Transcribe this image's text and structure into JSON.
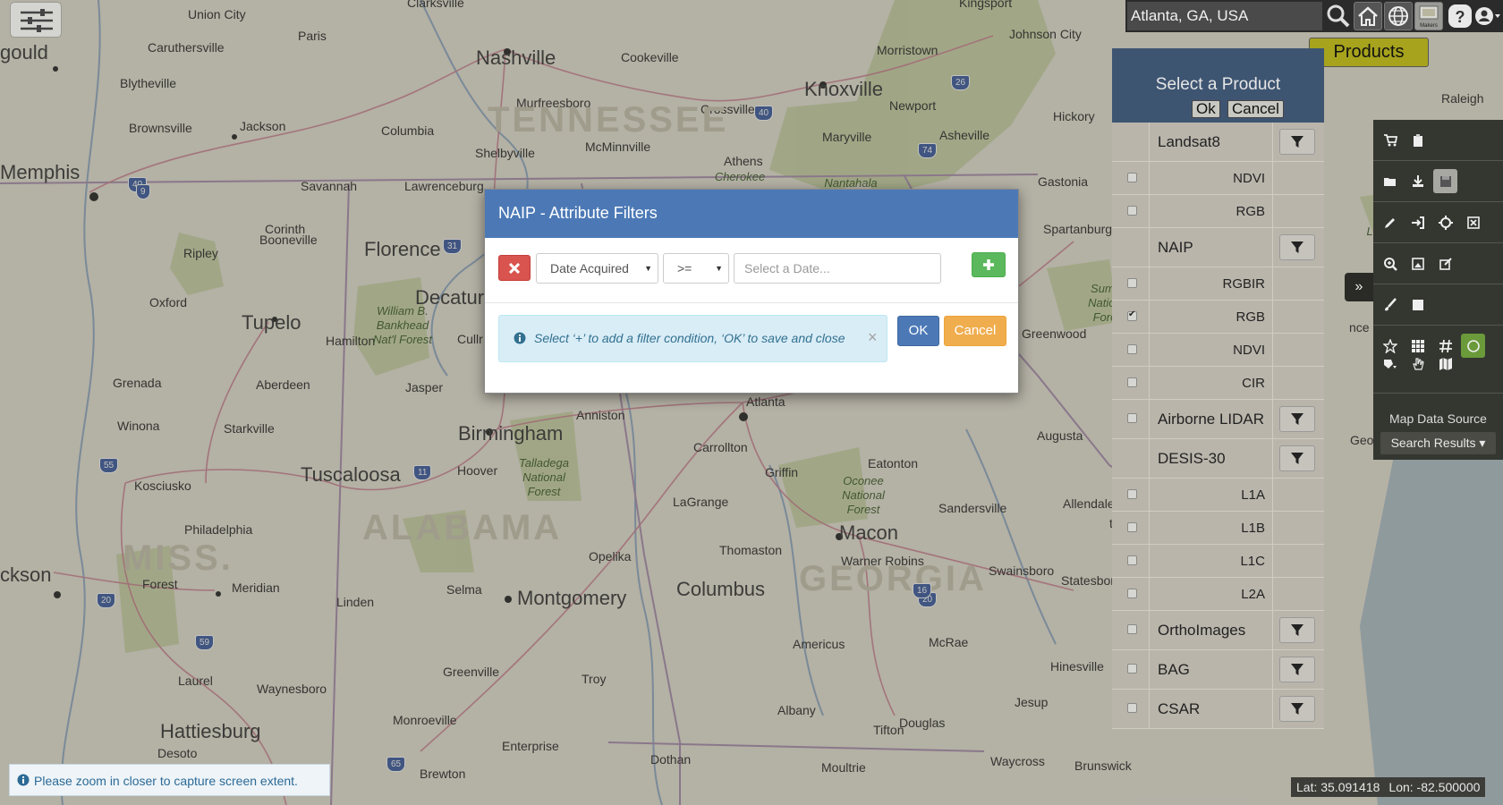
{
  "map": {
    "labels": [
      {
        "text": "Union City",
        "cls": ""
      },
      {
        "text": "Clarksville",
        "cls": ""
      },
      {
        "text": "Kingsport",
        "cls": ""
      },
      {
        "text": "Paris",
        "cls": ""
      },
      {
        "text": "Johnson City",
        "cls": ""
      },
      {
        "text": "Caruthersville",
        "cls": ""
      },
      {
        "text": "Nashville",
        "cls": "big"
      },
      {
        "text": "Cookeville",
        "cls": ""
      },
      {
        "text": "Morristown",
        "cls": ""
      },
      {
        "text": "Blytheville",
        "cls": ""
      },
      {
        "text": "Murfreesboro",
        "cls": ""
      },
      {
        "text": "Knoxville",
        "cls": "big"
      },
      {
        "text": "Raleigh",
        "cls": ""
      },
      {
        "text": "Brownsville",
        "cls": ""
      },
      {
        "text": "Jackson",
        "cls": ""
      },
      {
        "text": "Columbia",
        "cls": ""
      },
      {
        "text": "Crossville",
        "cls": ""
      },
      {
        "text": "Newport",
        "cls": ""
      },
      {
        "text": "Hickory",
        "cls": ""
      },
      {
        "text": "TENNESSEE",
        "cls": "state"
      },
      {
        "text": "Maryville",
        "cls": ""
      },
      {
        "text": "Asheville",
        "cls": ""
      },
      {
        "text": "Shelbyville",
        "cls": ""
      },
      {
        "text": "McMinnville",
        "cls": ""
      },
      {
        "text": "Memphis",
        "cls": "big"
      },
      {
        "text": "Athens",
        "cls": ""
      },
      {
        "text": "Savannah",
        "cls": ""
      },
      {
        "text": "Lawrenceburg",
        "cls": ""
      },
      {
        "text": "Gastonia",
        "cls": ""
      },
      {
        "text": "Corinth",
        "cls": ""
      },
      {
        "text": "Spartanburg",
        "cls": ""
      },
      {
        "text": "Ripley",
        "cls": ""
      },
      {
        "text": "Booneville",
        "cls": ""
      },
      {
        "text": "Florence",
        "cls": "big"
      },
      {
        "text": "Decatur",
        "cls": "big"
      },
      {
        "text": "Oxford",
        "cls": ""
      },
      {
        "text": "Tupelo",
        "cls": "big"
      },
      {
        "text": "Hamilton",
        "cls": ""
      },
      {
        "text": "Greenwood",
        "cls": ""
      },
      {
        "text": "Grenada",
        "cls": ""
      },
      {
        "text": "Aberdeen",
        "cls": ""
      },
      {
        "text": "Jasper",
        "cls": ""
      },
      {
        "text": "Anniston",
        "cls": ""
      },
      {
        "text": "Atlanta",
        "cls": ""
      },
      {
        "text": "Winona",
        "cls": ""
      },
      {
        "text": "Starkville",
        "cls": ""
      },
      {
        "text": "Birmingham",
        "cls": "big"
      },
      {
        "text": "Carrollton",
        "cls": ""
      },
      {
        "text": "Augusta",
        "cls": ""
      },
      {
        "text": "Tuscaloosa",
        "cls": "big"
      },
      {
        "text": "Hoover",
        "cls": ""
      },
      {
        "text": "Griffin",
        "cls": ""
      },
      {
        "text": "Eatonton",
        "cls": ""
      },
      {
        "text": "Kosciusko",
        "cls": ""
      },
      {
        "text": "Allendale",
        "cls": ""
      },
      {
        "text": "ALABAMA",
        "cls": "state"
      },
      {
        "text": "LaGrange",
        "cls": ""
      },
      {
        "text": "Sandersville",
        "cls": ""
      },
      {
        "text": "Philadelphia",
        "cls": ""
      },
      {
        "text": "Macon",
        "cls": "big"
      },
      {
        "text": "MISS.",
        "cls": "state"
      },
      {
        "text": "Opelika",
        "cls": ""
      },
      {
        "text": "Thomaston",
        "cls": ""
      },
      {
        "text": "ckson",
        "cls": "big"
      },
      {
        "text": "Forest",
        "cls": ""
      },
      {
        "text": "Meridian",
        "cls": ""
      },
      {
        "text": "Columbus",
        "cls": "big"
      },
      {
        "text": "Warner Robins",
        "cls": ""
      },
      {
        "text": "Swainsboro",
        "cls": ""
      },
      {
        "text": "GEORGIA",
        "cls": "state"
      },
      {
        "text": "Statesboro",
        "cls": ""
      },
      {
        "text": "Linden",
        "cls": ""
      },
      {
        "text": "Selma",
        "cls": ""
      },
      {
        "text": "Montgomery",
        "cls": "big"
      },
      {
        "text": "Americus",
        "cls": ""
      },
      {
        "text": "McRae",
        "cls": ""
      },
      {
        "text": "Greenville",
        "cls": ""
      },
      {
        "text": "Hinesville",
        "cls": ""
      },
      {
        "text": "Laurel",
        "cls": ""
      },
      {
        "text": "Waynesboro",
        "cls": ""
      },
      {
        "text": "Troy",
        "cls": ""
      },
      {
        "text": "Jesup",
        "cls": ""
      },
      {
        "text": "Albany",
        "cls": ""
      },
      {
        "text": "Hattiesburg",
        "cls": "big"
      },
      {
        "text": "Monroeville",
        "cls": ""
      },
      {
        "text": "Tifton",
        "cls": ""
      },
      {
        "text": "Douglas",
        "cls": ""
      },
      {
        "text": "Enterprise",
        "cls": ""
      },
      {
        "text": "Desoto",
        "cls": ""
      },
      {
        "text": "Dothan",
        "cls": ""
      },
      {
        "text": "Brewton",
        "cls": ""
      },
      {
        "text": "Moultrie",
        "cls": ""
      },
      {
        "text": "Waycross",
        "cls": ""
      },
      {
        "text": "Brunswick",
        "cls": ""
      },
      {
        "text": "ton",
        "cls": ""
      },
      {
        "text": "Geo",
        "cls": ""
      },
      {
        "text": "nce",
        "cls": ""
      },
      {
        "text": "gould",
        "cls": "big"
      },
      {
        "text": "Sumter National Forest",
        "cls": "forest"
      },
      {
        "text": "William B. Bankhead Nat'l Forest",
        "cls": "forest"
      },
      {
        "text": "Talladega National Forest",
        "cls": "forest"
      },
      {
        "text": "Oconee National Forest",
        "cls": "forest"
      },
      {
        "text": "Cherokee",
        "cls": "forest"
      },
      {
        "text": "Nantahala",
        "cls": "forest"
      },
      {
        "text": "Cullr",
        "cls": ""
      },
      {
        "text": "Lumbe Sdsa",
        "cls": "forest"
      }
    ],
    "highway_shields": [
      "40",
      "40",
      "26",
      "74",
      "31",
      "20",
      "11",
      "55",
      "20",
      "59",
      "65",
      "16",
      "40",
      "9"
    ]
  },
  "top_bar": {
    "menu_icon": "sliders-menu-icon",
    "search_value": "Atlanta, GA, USA",
    "icons": [
      "search-icon",
      "home-icon",
      "globe-icon",
      "basemap-icon",
      "help-icon",
      "user-icon"
    ],
    "basemap_caption": "Makers"
  },
  "products_button": {
    "label": "Products"
  },
  "product_panel": {
    "title": "Select a Product",
    "ok_label": "Ok",
    "cancel_label": "Cancel",
    "rows": [
      {
        "type": "group",
        "label": "Landsat8",
        "filter": true,
        "height": 44
      },
      {
        "type": "item",
        "label": "NDVI",
        "checked": false,
        "height": 37
      },
      {
        "type": "item",
        "label": "RGB",
        "checked": false,
        "height": 37
      },
      {
        "type": "group",
        "label": "NAIP",
        "filter": true,
        "height": 44
      },
      {
        "type": "item",
        "label": "RGBIR",
        "checked": false,
        "height": 37
      },
      {
        "type": "item",
        "label": "RGB",
        "checked": true,
        "height": 37
      },
      {
        "type": "item",
        "label": "NDVI",
        "checked": false,
        "height": 37
      },
      {
        "type": "item",
        "label": "CIR",
        "checked": false,
        "height": 37
      },
      {
        "type": "group",
        "label": "Airborne LIDAR",
        "filter": true,
        "checkbox": true,
        "height": 44
      },
      {
        "type": "group",
        "label": "DESIS-30",
        "filter": true,
        "height": 44
      },
      {
        "type": "item",
        "label": "L1A",
        "checked": false,
        "height": 37
      },
      {
        "type": "item",
        "label": "L1B",
        "checked": false,
        "height": 37
      },
      {
        "type": "item",
        "label": "L1C",
        "checked": false,
        "height": 37
      },
      {
        "type": "item",
        "label": "L2A",
        "checked": false,
        "height": 37
      },
      {
        "type": "group",
        "label": "OrthoImages",
        "filter": true,
        "checkbox": true,
        "height": 44
      },
      {
        "type": "group",
        "label": "BAG",
        "filter": true,
        "checkbox": true,
        "height": 44
      },
      {
        "type": "group",
        "label": "CSAR",
        "filter": true,
        "checkbox": true,
        "height": 44
      }
    ]
  },
  "right_toolbar": {
    "rows": [
      [
        "cart-icon",
        "clipboard-icon"
      ],
      [
        "folder-open-icon",
        "download-icon",
        "save-icon"
      ],
      [
        "pencil-icon",
        "sign-in-icon",
        "crosshair-icon",
        "close-box-icon"
      ],
      [
        "zoom-in-icon",
        "picture-icon",
        "edit-icon"
      ],
      [
        "brush-icon",
        "square-icon"
      ],
      [
        "star-icon",
        "grid-icon",
        "hash-icon",
        "circle-icon"
      ],
      [
        "polygon-dropdown-icon",
        "hand-icon",
        "map-icon"
      ]
    ],
    "expand_icon": "double-chevron-right-icon",
    "map_data_source_label": "Map Data Source",
    "search_results_label": "Search Results ▾"
  },
  "modal": {
    "title": "NAIP - Attribute Filters",
    "filter": {
      "attribute": "Date Acquired",
      "operator": ">=",
      "date_placeholder": "Select a Date..."
    },
    "info_text": "Select ‘+’ to add a filter condition, ‘OK’ to save and close",
    "info_close": "×",
    "ok_label": "OK",
    "cancel_label": "Cancel",
    "colors": {
      "header": "#4c79b6",
      "remove": "#d9534f",
      "add": "#5cb85c",
      "cancel": "#f0ad4e"
    }
  },
  "zoom_notice": {
    "text": "Please zoom in closer to capture screen extent."
  },
  "coordinates": {
    "lat": "Lat: 35.091418",
    "lon": "Lon: -82.500000"
  }
}
